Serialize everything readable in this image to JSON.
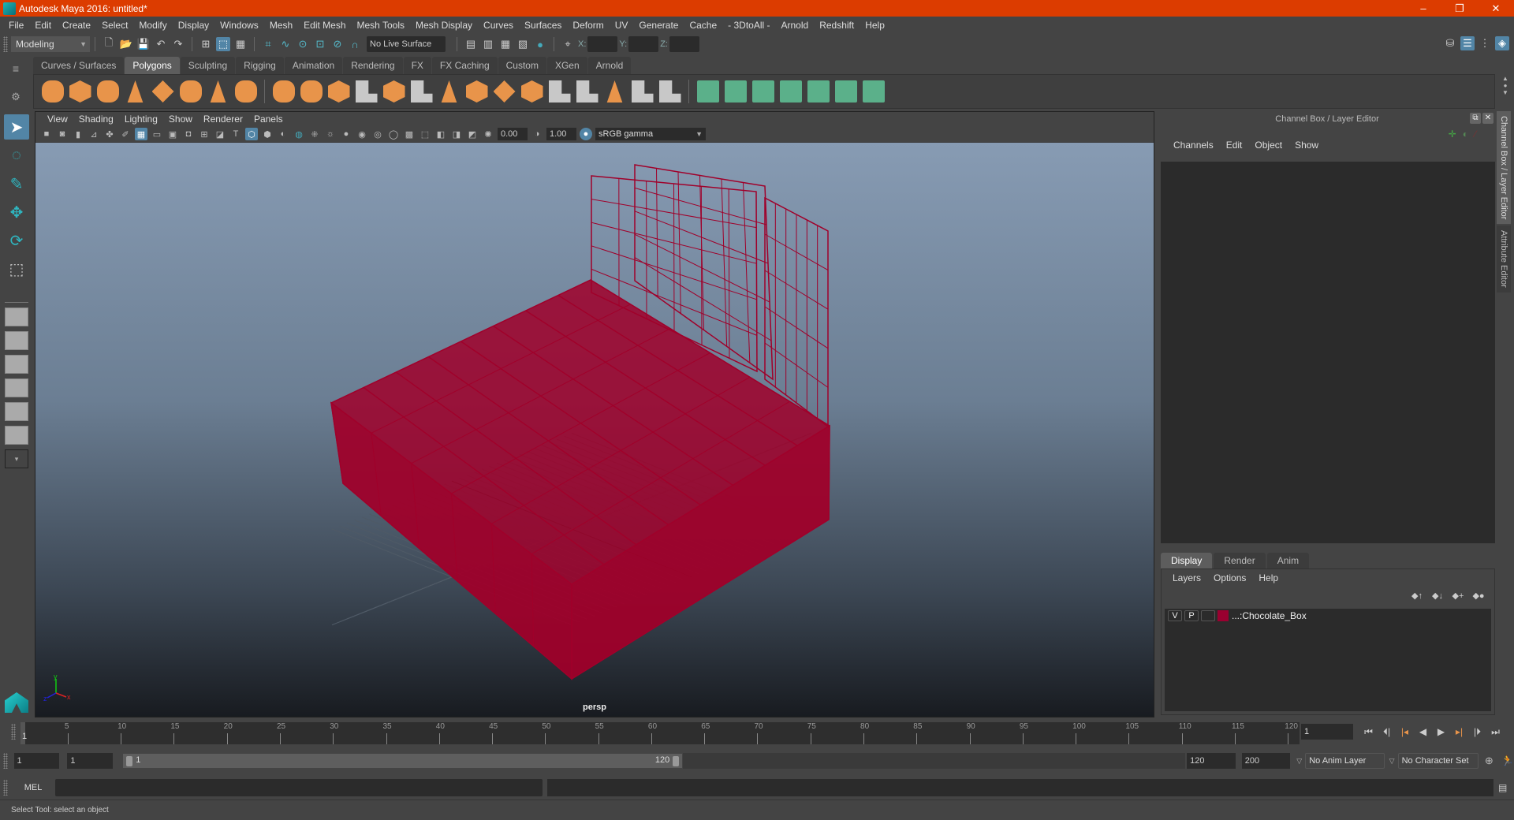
{
  "window": {
    "title": "Autodesk Maya 2016: untitled*",
    "controls": [
      "–",
      "❐",
      "✕"
    ]
  },
  "menubar": [
    "File",
    "Edit",
    "Create",
    "Select",
    "Modify",
    "Display",
    "Windows",
    "Mesh",
    "Edit Mesh",
    "Mesh Tools",
    "Mesh Display",
    "Curves",
    "Surfaces",
    "Deform",
    "UV",
    "Generate",
    "Cache",
    "- 3DtoAll -",
    "Arnold",
    "Redshift",
    "Help"
  ],
  "statusline": {
    "mode": "Modeling",
    "live_surface": "No Live Surface",
    "coord_labels": {
      "x": "X:",
      "y": "Y:",
      "z": "Z:"
    },
    "coords": {
      "x": "",
      "y": "",
      "z": ""
    }
  },
  "shelf": {
    "tabs": [
      "Curves / Surfaces",
      "Polygons",
      "Sculpting",
      "Rigging",
      "Animation",
      "Rendering",
      "FX",
      "FX Caching",
      "Custom",
      "XGen",
      "Arnold"
    ],
    "active_tab": "Polygons",
    "icons": [
      {
        "name": "poly-sphere-icon",
        "style": "o2"
      },
      {
        "name": "poly-cube-icon",
        "style": "o"
      },
      {
        "name": "poly-cylinder-icon",
        "style": "o2"
      },
      {
        "name": "poly-cone-icon",
        "style": "o4"
      },
      {
        "name": "poly-plane-icon",
        "style": "o3"
      },
      {
        "name": "poly-torus-icon",
        "style": "o2"
      },
      {
        "name": "poly-pyramid-icon",
        "style": "o4"
      },
      {
        "name": "poly-pipe-icon",
        "style": "o2"
      },
      {
        "name": "combine-icon",
        "style": "o2"
      },
      {
        "name": "separate-icon",
        "style": "o2"
      },
      {
        "name": "mirror-icon",
        "style": "o"
      },
      {
        "name": "smooth-icon",
        "style": "g"
      },
      {
        "name": "reduce-icon",
        "style": "o"
      },
      {
        "name": "bevel-icon",
        "style": "g"
      },
      {
        "name": "multi-cut-icon",
        "style": "o4"
      },
      {
        "name": "extrude-icon",
        "style": "o"
      },
      {
        "name": "bridge-icon",
        "style": "o3"
      },
      {
        "name": "target-weld-icon",
        "style": "o"
      },
      {
        "name": "insert-edge-loop-icon",
        "style": "g"
      },
      {
        "name": "offset-edge-loop-icon",
        "style": "g"
      },
      {
        "name": "bevel-edge-icon",
        "style": "o4"
      },
      {
        "name": "fill-hole-icon",
        "style": "g"
      },
      {
        "name": "append-polygon-icon",
        "style": "g"
      },
      {
        "name": "planar-mapping-icon",
        "style": "t"
      },
      {
        "name": "cylindrical-mapping-icon",
        "style": "t"
      },
      {
        "name": "spherical-mapping-icon",
        "style": "t"
      },
      {
        "name": "automatic-mapping-icon",
        "style": "t"
      },
      {
        "name": "unfold-icon",
        "style": "t"
      },
      {
        "name": "uv-editor-icon",
        "style": "t"
      },
      {
        "name": "cut-uv-icon",
        "style": "t"
      }
    ]
  },
  "toolbox": [
    "select-tool-icon",
    "lasso-tool-icon",
    "paint-select-tool-icon",
    "move-tool-icon",
    "rotate-tool-icon",
    "scale-tool-icon"
  ],
  "viewport": {
    "menu": [
      "View",
      "Shading",
      "Lighting",
      "Show",
      "Renderer",
      "Panels"
    ],
    "exposure": "0.00",
    "gamma": "1.00",
    "color_space": "sRGB gamma",
    "camera_label": "persp",
    "wire_color": "#a0002a"
  },
  "right_panel": {
    "title": "Channel Box / Layer Editor",
    "menu": [
      "Channels",
      "Edit",
      "Object",
      "Show"
    ],
    "layer_tabs": [
      "Display",
      "Render",
      "Anim"
    ],
    "active_layer_tab": "Display",
    "layer_menu": [
      "Layers",
      "Options",
      "Help"
    ],
    "layers": [
      {
        "v": "V",
        "p": "P",
        "color": "#9a0030",
        "name": "...:Chocolate_Box"
      }
    ]
  },
  "side_tabs": [
    "Channel Box / Layer Editor",
    "Attribute Editor"
  ],
  "timeline": {
    "ticks": [
      5,
      10,
      15,
      20,
      25,
      30,
      35,
      40,
      45,
      50,
      55,
      60,
      65,
      70,
      75,
      80,
      85,
      90,
      95,
      100,
      105,
      110,
      115,
      120
    ],
    "start": 1,
    "end": 120,
    "current_frame": "1"
  },
  "range": {
    "start_time": "1",
    "playback_start": "1",
    "slider_start": "1",
    "slider_end": "120",
    "playback_end": "120",
    "end_time": "200",
    "anim_layer": "No Anim Layer",
    "character_set": "No Character Set"
  },
  "command_line": {
    "label": "MEL",
    "value": ""
  },
  "help_line": "Select Tool: select an object"
}
